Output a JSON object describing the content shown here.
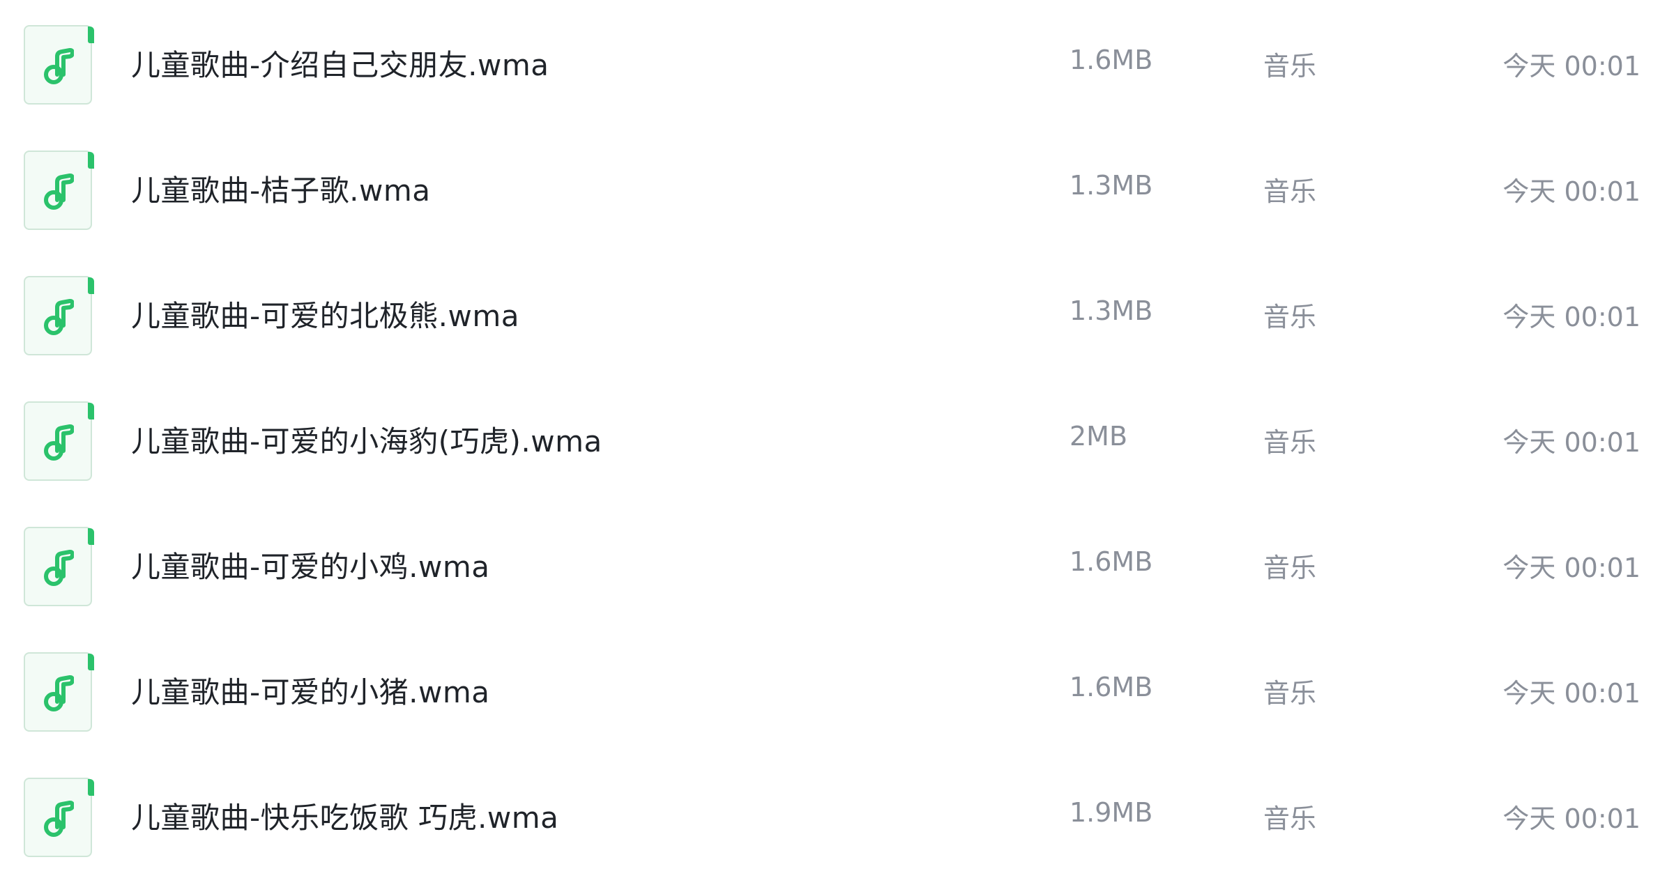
{
  "accent_color": "#2bc26b",
  "files": [
    {
      "name": "儿童歌曲-介绍自己交朋友.wma",
      "size": "1.6MB",
      "type": "音乐",
      "modified": "今天 00:01",
      "icon": "music-note-icon"
    },
    {
      "name": "儿童歌曲-桔子歌.wma",
      "size": "1.3MB",
      "type": "音乐",
      "modified": "今天 00:01",
      "icon": "music-note-icon"
    },
    {
      "name": "儿童歌曲-可爱的北极熊.wma",
      "size": "1.3MB",
      "type": "音乐",
      "modified": "今天 00:01",
      "icon": "music-note-icon"
    },
    {
      "name": "儿童歌曲-可爱的小海豹(巧虎).wma",
      "size": "2MB",
      "type": "音乐",
      "modified": "今天 00:01",
      "icon": "music-note-icon"
    },
    {
      "name": "儿童歌曲-可爱的小鸡.wma",
      "size": "1.6MB",
      "type": "音乐",
      "modified": "今天 00:01",
      "icon": "music-note-icon"
    },
    {
      "name": "儿童歌曲-可爱的小猪.wma",
      "size": "1.6MB",
      "type": "音乐",
      "modified": "今天 00:01",
      "icon": "music-note-icon"
    },
    {
      "name": "儿童歌曲-快乐吃饭歌 巧虎.wma",
      "size": "1.9MB",
      "type": "音乐",
      "modified": "今天 00:01",
      "icon": "music-note-icon"
    }
  ]
}
